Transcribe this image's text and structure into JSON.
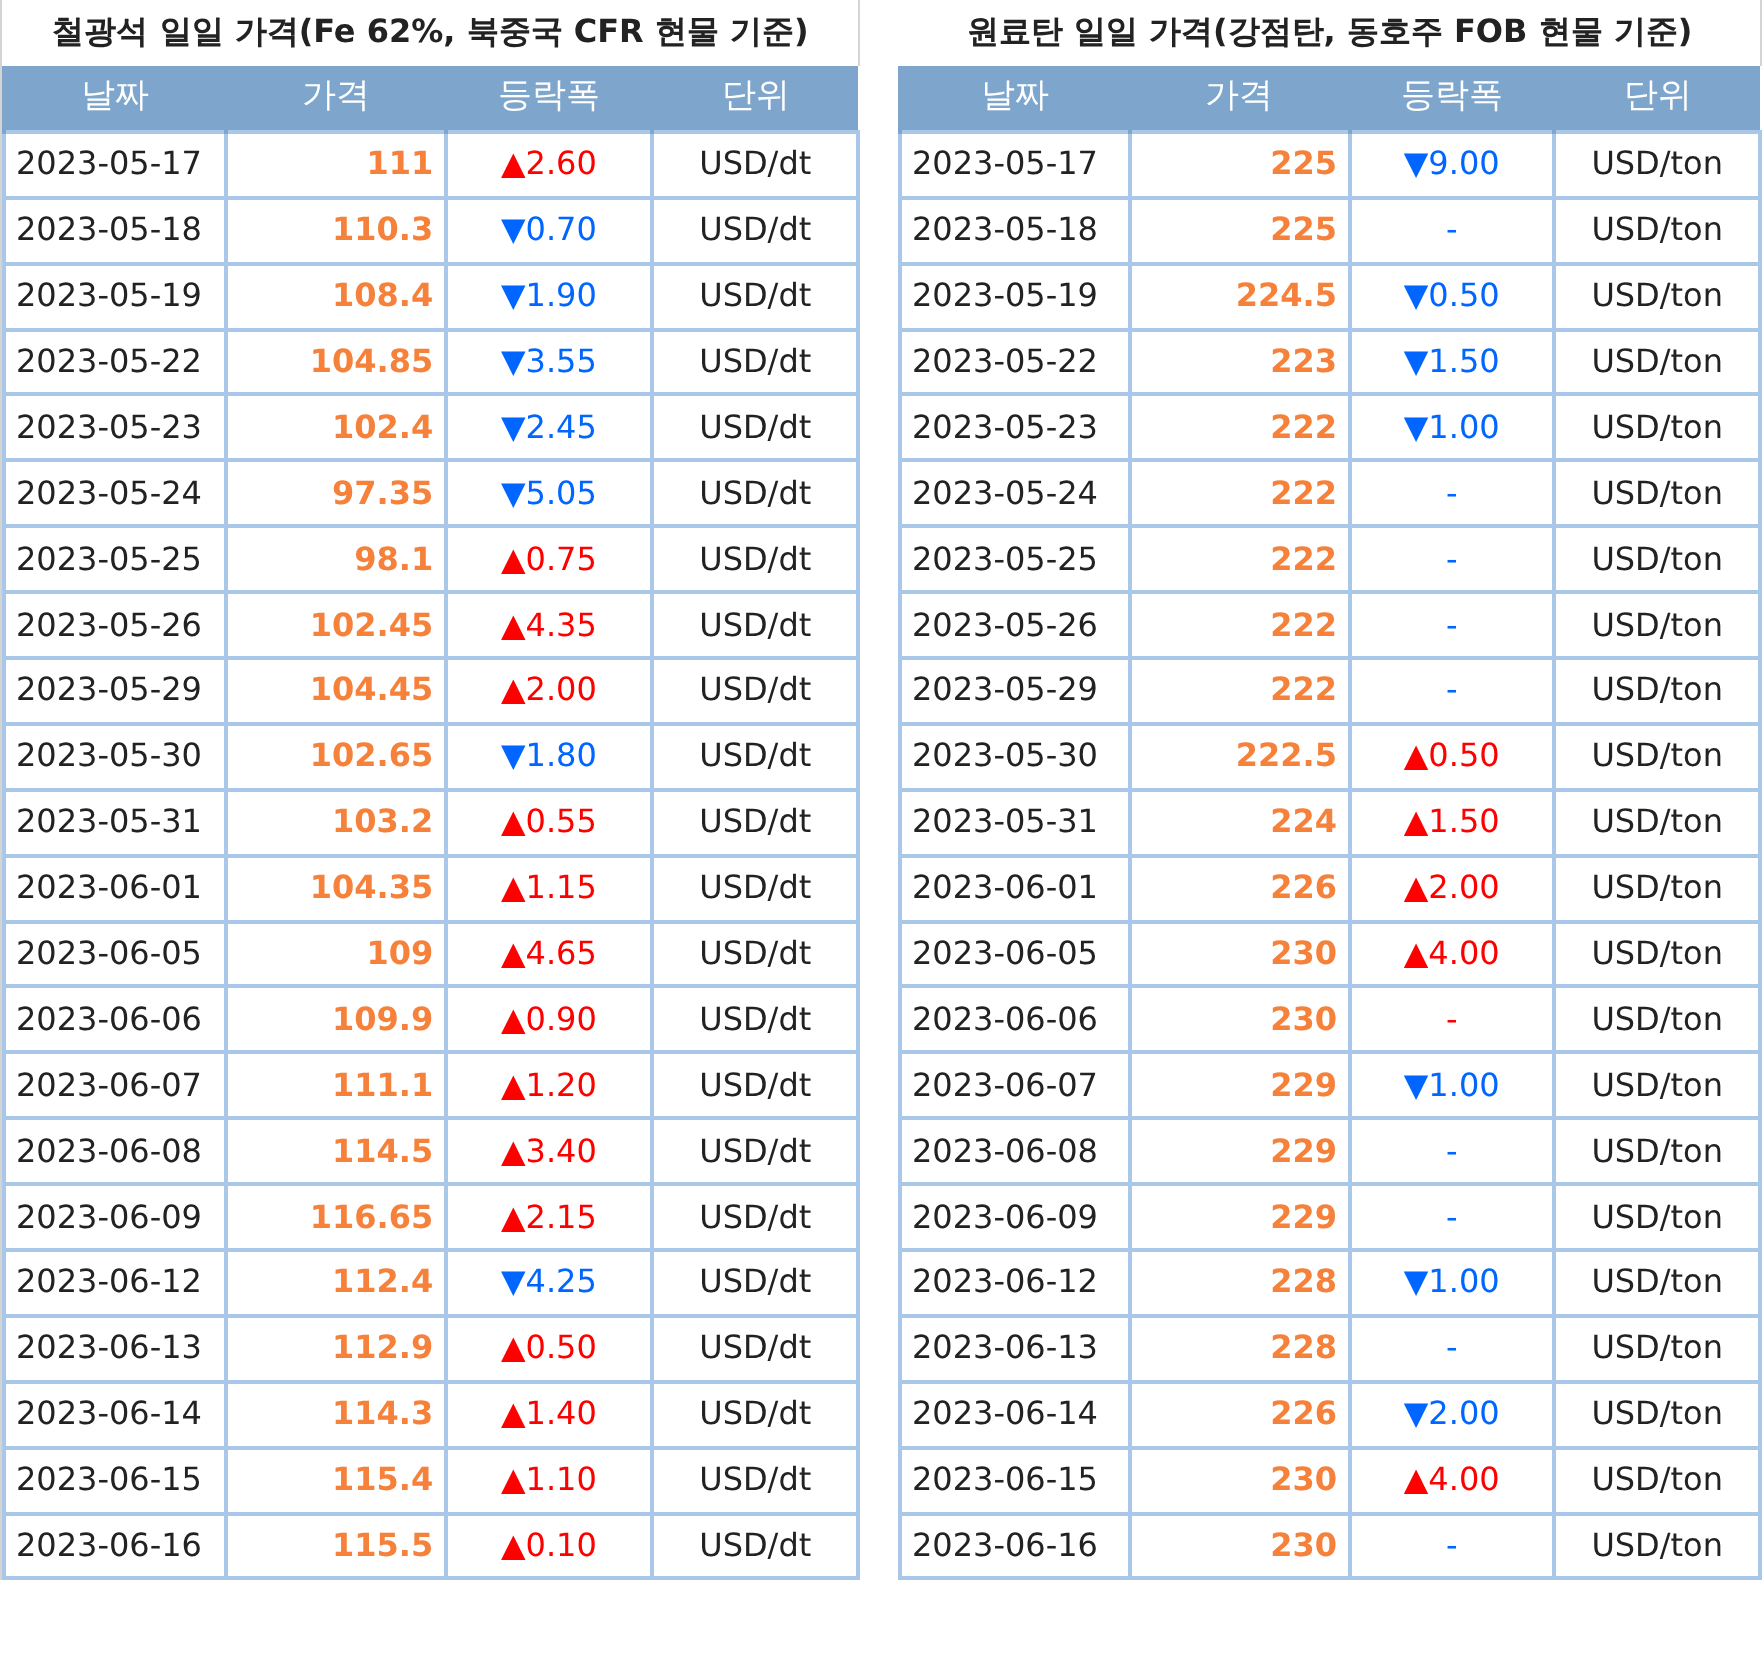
{
  "tables": [
    {
      "title": "철광석 일일 가격(Fe 62%, 북중국 CFR 현물 기준)",
      "columns": [
        "날짜",
        "가격",
        "등락폭",
        "단위"
      ],
      "rows": [
        {
          "date": "2023-05-17",
          "price": "111",
          "change": "▲2.60",
          "color": "#ff0000",
          "unit": "USD/dt"
        },
        {
          "date": "2023-05-18",
          "price": "110.3",
          "change": "▼0.70",
          "color": "#0066ff",
          "unit": "USD/dt"
        },
        {
          "date": "2023-05-19",
          "price": "108.4",
          "change": "▼1.90",
          "color": "#0066ff",
          "unit": "USD/dt"
        },
        {
          "date": "2023-05-22",
          "price": "104.85",
          "change": "▼3.55",
          "color": "#0066ff",
          "unit": "USD/dt"
        },
        {
          "date": "2023-05-23",
          "price": "102.4",
          "change": "▼2.45",
          "color": "#0066ff",
          "unit": "USD/dt"
        },
        {
          "date": "2023-05-24",
          "price": "97.35",
          "change": "▼5.05",
          "color": "#0066ff",
          "unit": "USD/dt"
        },
        {
          "date": "2023-05-25",
          "price": "98.1",
          "change": "▲0.75",
          "color": "#ff0000",
          "unit": "USD/dt"
        },
        {
          "date": "2023-05-26",
          "price": "102.45",
          "change": "▲4.35",
          "color": "#ff0000",
          "unit": "USD/dt"
        },
        {
          "date": "2023-05-29",
          "price": "104.45",
          "change": "▲2.00",
          "color": "#ff0000",
          "unit": "USD/dt"
        },
        {
          "date": "2023-05-30",
          "price": "102.65",
          "change": "▼1.80",
          "color": "#0066ff",
          "unit": "USD/dt"
        },
        {
          "date": "2023-05-31",
          "price": "103.2",
          "change": "▲0.55",
          "color": "#ff0000",
          "unit": "USD/dt"
        },
        {
          "date": "2023-06-01",
          "price": "104.35",
          "change": "▲1.15",
          "color": "#ff0000",
          "unit": "USD/dt"
        },
        {
          "date": "2023-06-05",
          "price": "109",
          "change": "▲4.65",
          "color": "#ff0000",
          "unit": "USD/dt"
        },
        {
          "date": "2023-06-06",
          "price": "109.9",
          "change": "▲0.90",
          "color": "#ff0000",
          "unit": "USD/dt"
        },
        {
          "date": "2023-06-07",
          "price": "111.1",
          "change": "▲1.20",
          "color": "#ff0000",
          "unit": "USD/dt"
        },
        {
          "date": "2023-06-08",
          "price": "114.5",
          "change": "▲3.40",
          "color": "#ff0000",
          "unit": "USD/dt"
        },
        {
          "date": "2023-06-09",
          "price": "116.65",
          "change": "▲2.15",
          "color": "#ff0000",
          "unit": "USD/dt"
        },
        {
          "date": "2023-06-12",
          "price": "112.4",
          "change": "▼4.25",
          "color": "#0066ff",
          "unit": "USD/dt"
        },
        {
          "date": "2023-06-13",
          "price": "112.9",
          "change": "▲0.50",
          "color": "#ff0000",
          "unit": "USD/dt"
        },
        {
          "date": "2023-06-14",
          "price": "114.3",
          "change": "▲1.40",
          "color": "#ff0000",
          "unit": "USD/dt"
        },
        {
          "date": "2023-06-15",
          "price": "115.4",
          "change": "▲1.10",
          "color": "#ff0000",
          "unit": "USD/dt"
        },
        {
          "date": "2023-06-16",
          "price": "115.5",
          "change": "▲0.10",
          "color": "#ff0000",
          "unit": "USD/dt"
        }
      ]
    },
    {
      "title": "원료탄 일일 가격(강점탄, 동호주 FOB 현물 기준)",
      "columns": [
        "날짜",
        "가격",
        "등락폭",
        "단위"
      ],
      "rows": [
        {
          "date": "2023-05-17",
          "price": "225",
          "change": "▼9.00",
          "color": "#0066ff",
          "unit": "USD/ton"
        },
        {
          "date": "2023-05-18",
          "price": "225",
          "change": "-",
          "color": "#0066ff",
          "unit": "USD/ton"
        },
        {
          "date": "2023-05-19",
          "price": "224.5",
          "change": "▼0.50",
          "color": "#0066ff",
          "unit": "USD/ton"
        },
        {
          "date": "2023-05-22",
          "price": "223",
          "change": "▼1.50",
          "color": "#0066ff",
          "unit": "USD/ton"
        },
        {
          "date": "2023-05-23",
          "price": "222",
          "change": "▼1.00",
          "color": "#0066ff",
          "unit": "USD/ton"
        },
        {
          "date": "2023-05-24",
          "price": "222",
          "change": "-",
          "color": "#0066ff",
          "unit": "USD/ton"
        },
        {
          "date": "2023-05-25",
          "price": "222",
          "change": "-",
          "color": "#0066ff",
          "unit": "USD/ton"
        },
        {
          "date": "2023-05-26",
          "price": "222",
          "change": "-",
          "color": "#0066ff",
          "unit": "USD/ton"
        },
        {
          "date": "2023-05-29",
          "price": "222",
          "change": "-",
          "color": "#0066ff",
          "unit": "USD/ton"
        },
        {
          "date": "2023-05-30",
          "price": "222.5",
          "change": "▲0.50",
          "color": "#ff0000",
          "unit": "USD/ton"
        },
        {
          "date": "2023-05-31",
          "price": "224",
          "change": "▲1.50",
          "color": "#ff0000",
          "unit": "USD/ton"
        },
        {
          "date": "2023-06-01",
          "price": "226",
          "change": "▲2.00",
          "color": "#ff0000",
          "unit": "USD/ton"
        },
        {
          "date": "2023-06-05",
          "price": "230",
          "change": "▲4.00",
          "color": "#ff0000",
          "unit": "USD/ton"
        },
        {
          "date": "2023-06-06",
          "price": "230",
          "change": "-",
          "color": "#ff0000",
          "unit": "USD/ton"
        },
        {
          "date": "2023-06-07",
          "price": "229",
          "change": "▼1.00",
          "color": "#0066ff",
          "unit": "USD/ton"
        },
        {
          "date": "2023-06-08",
          "price": "229",
          "change": "-",
          "color": "#0066ff",
          "unit": "USD/ton"
        },
        {
          "date": "2023-06-09",
          "price": "229",
          "change": "-",
          "color": "#0066ff",
          "unit": "USD/ton"
        },
        {
          "date": "2023-06-12",
          "price": "228",
          "change": "▼1.00",
          "color": "#0066ff",
          "unit": "USD/ton"
        },
        {
          "date": "2023-06-13",
          "price": "228",
          "change": "-",
          "color": "#0066ff",
          "unit": "USD/ton"
        },
        {
          "date": "2023-06-14",
          "price": "226",
          "change": "▼2.00",
          "color": "#0066ff",
          "unit": "USD/ton"
        },
        {
          "date": "2023-06-15",
          "price": "230",
          "change": "▲4.00",
          "color": "#ff0000",
          "unit": "USD/ton"
        },
        {
          "date": "2023-06-16",
          "price": "230",
          "change": "-",
          "color": "#0066ff",
          "unit": "USD/ton"
        }
      ]
    }
  ]
}
